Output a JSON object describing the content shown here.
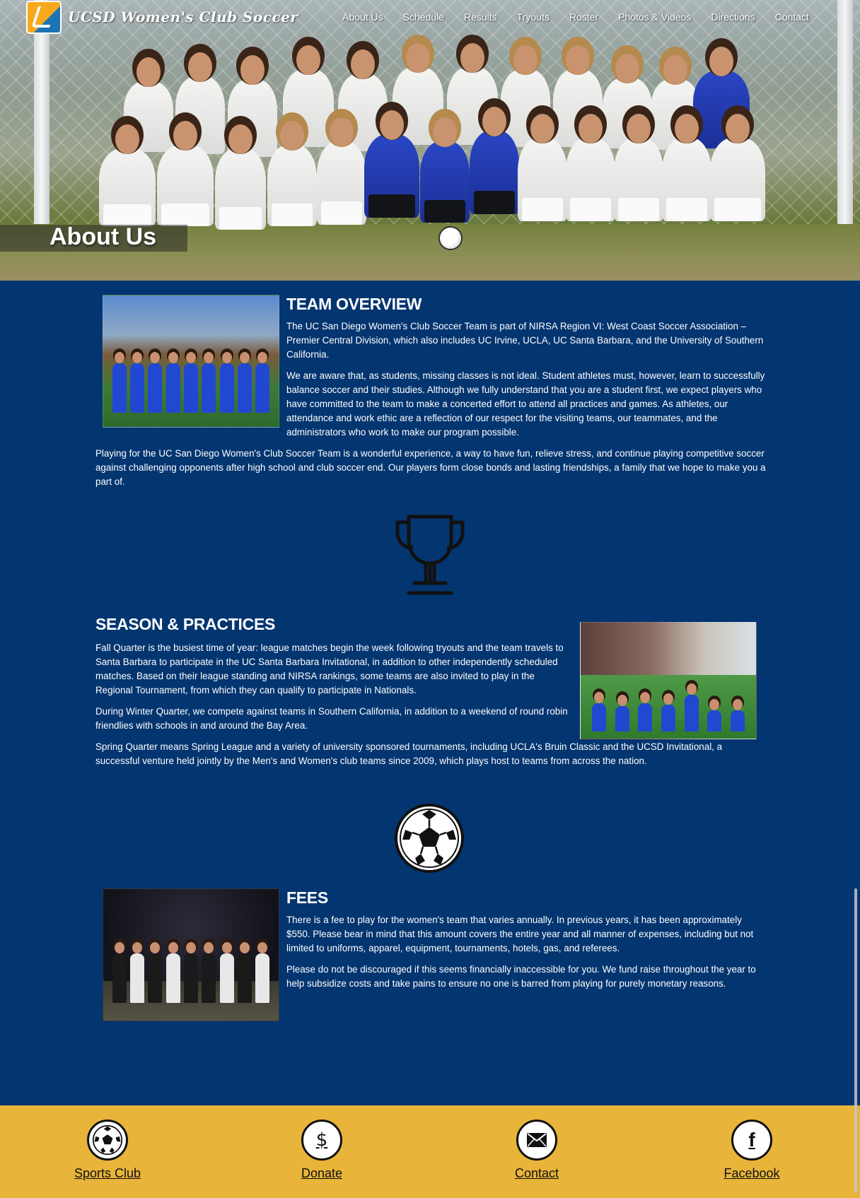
{
  "header": {
    "brand": "UCSD Women's Club Soccer",
    "nav": [
      "About Us",
      "Schedule",
      "Results",
      "Tryouts",
      "Roster",
      "Photos & Videos",
      "Directions",
      "Contact"
    ],
    "hero_title": "About Us"
  },
  "sections": {
    "overview": {
      "title": "TEAM OVERVIEW",
      "p1": "The UC San Diego Women's Club Soccer Team is part of NIRSA Region VI: West Coast Soccer Association – Premier Central Division, which also includes UC Irvine, UCLA, UC Santa Barbara, and the University of Southern California.",
      "p2": "We are aware that, as students, missing classes is not ideal. Student athletes must, however, learn to successfully balance soccer and their studies. Although we fully understand that you are a student first, we expect players who have committed to the team to make a concerted effort to attend all practices and games. As athletes, our attendance and work ethic are a reflection of our respect for the visiting teams, our teammates, and the administrators who work to make our program possible.",
      "p3": "Playing for the UC San Diego Women's Club Soccer Team is a wonderful experience, a way to have fun, relieve stress, and continue playing competitive soccer against challenging opponents after high school and club soccer end. Our players form close bonds and lasting friendships, a family that we hope to make you a part of."
    },
    "season": {
      "title": "SEASON & PRACTICES",
      "p1": "Fall Quarter is the busiest time of year: league matches begin the week following tryouts and the team travels to Santa Barbara to participate in the UC Santa Barbara Invitational, in addition to other independently scheduled matches. Based on their league standing and NIRSA rankings, some teams are also invited to play in the Regional Tournament, from which they can qualify to participate in Nationals.",
      "p2": "During Winter Quarter, we compete against teams in Southern California, in addition to a weekend of round robin friendlies with schools in and around the Bay Area.",
      "p3": "Spring Quarter means Spring League and a variety of university sponsored tournaments, including UCLA's Bruin Classic and the UCSD Invitational, a successful venture held jointly by the Men's and Women's club teams since 2009, which plays host to teams from across the nation."
    },
    "fees": {
      "title": "FEES",
      "p1": "There is a fee to play for the women's team that varies annually. In previous years, it has been approximately $550. Please bear in mind that this amount covers the entire year and all manner of expenses, including but not limited to uniforms, apparel, equipment, tournaments, hotels, gas, and referees.",
      "p2": "Please do not be discouraged if this seems financially inaccessible for you. We fund raise throughout the year to help subsidize costs and take pains to ensure no one is barred from playing for purely monetary reasons."
    }
  },
  "footer": {
    "items": [
      {
        "label": "Sports Club",
        "icon": "soccer-ball-icon"
      },
      {
        "label": "Donate",
        "icon": "dollar-icon"
      },
      {
        "label": "Contact",
        "icon": "envelope-icon"
      },
      {
        "label": "Facebook",
        "icon": "facebook-icon"
      }
    ]
  },
  "colors": {
    "page_background": "#033570",
    "footer_background": "#e8b43a",
    "text": "#ffffff"
  }
}
